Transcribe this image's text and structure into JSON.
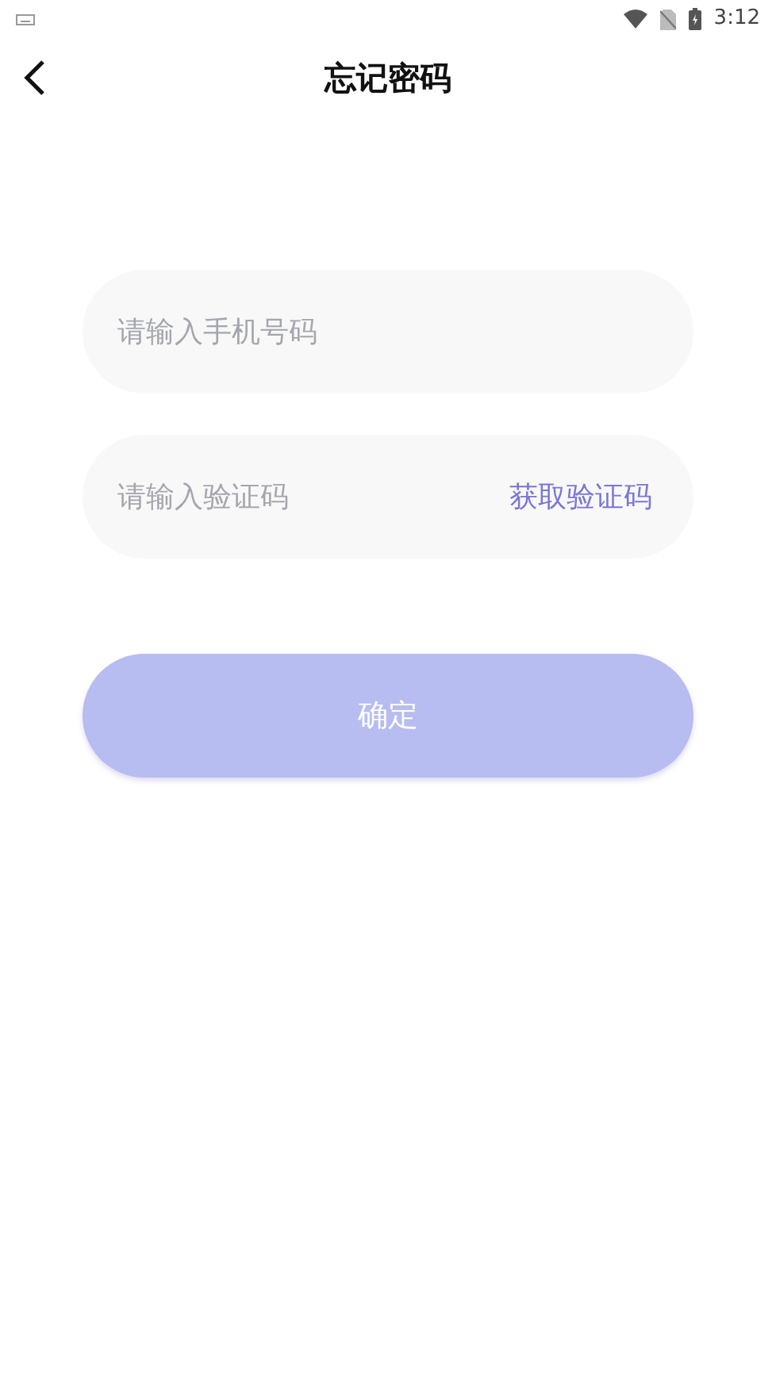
{
  "status_bar": {
    "time": "3:12"
  },
  "header": {
    "title": "忘记密码"
  },
  "fields": [
    {
      "kind": "phone",
      "placeholder": "请输入手机号码"
    },
    {
      "kind": "code",
      "placeholder": "请输入验证码",
      "action": "获取验证码"
    }
  ],
  "confirm_button": {
    "label": "确定",
    "disabled": true
  }
}
